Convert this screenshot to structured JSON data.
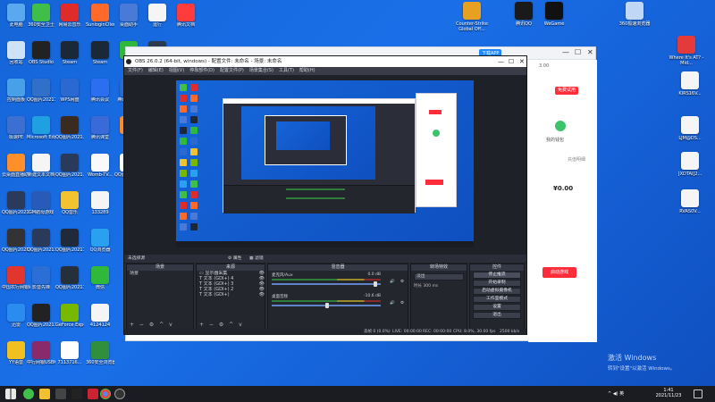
{
  "desktop": {
    "col1": [
      {
        "label": "此电脑",
        "color": "#5aa9f0"
      },
      {
        "label": "回收站",
        "color": "#cfe3f7"
      },
      {
        "label": "控制面板",
        "color": "#47a0e8"
      },
      {
        "label": "极速PE",
        "color": "#3b6fd1"
      },
      {
        "label": "云桌面直播助手",
        "color": "#ff8f2b"
      },
      {
        "label": "QQ图片20211017...",
        "color": "#2a3a5a"
      },
      {
        "label": "QQ图片20211017...",
        "color": "#333"
      },
      {
        "label": "中国农行网银助手",
        "color": "#e0362e"
      },
      {
        "label": "迅雷",
        "color": "#2b8cf0"
      },
      {
        "label": "YY语音",
        "color": "#f0c020"
      }
    ],
    "col2": [
      {
        "label": "360安全卫士",
        "color": "#3fbf4a"
      },
      {
        "label": "OBS Studio",
        "color": "#222"
      },
      {
        "label": "QQ图片20211017...",
        "color": "#3070c8"
      },
      {
        "label": "Microsoft Edge",
        "color": "#1fa0e0"
      },
      {
        "label": "新建文本文档",
        "color": "#f5f5f5"
      },
      {
        "label": "GM航母游戏",
        "color": "#2a5ab8"
      },
      {
        "label": "QQ图片20211016...",
        "color": "#2a3a5a"
      },
      {
        "label": "影音先锋",
        "color": "#2b6fd6"
      },
      {
        "label": "QQ图片20211017...",
        "color": "#222"
      },
      {
        "label": "中行网银USBKey",
        "color": "#8a2a6a"
      }
    ],
    "col3": [
      {
        "label": "网易云音乐",
        "color": "#e02b2b"
      },
      {
        "label": "Steam",
        "color": "#1b2838"
      },
      {
        "label": "WPS网盘",
        "color": "#2a6ad0"
      },
      {
        "label": "QQ图片2021...",
        "color": "#3a2a20"
      },
      {
        "label": "QQ图片2021...",
        "color": "#2a3a5a"
      },
      {
        "label": "QQ音乐",
        "color": "#f2c230"
      },
      {
        "label": "QQ图片20211016...",
        "color": "#202a3a"
      },
      {
        "label": "QQ图片20211016...",
        "color": "#25303a"
      },
      {
        "label": "GeForce Experience",
        "color": "#76b900"
      },
      {
        "label": "7113716...",
        "color": "#ffffff"
      }
    ],
    "col4": [
      {
        "label": "SunloginClient",
        "color": "#ff6a2b"
      },
      {
        "label": "Steam",
        "color": "#1b2838"
      },
      {
        "label": "腾讯会议",
        "color": "#2b6ff0"
      },
      {
        "label": "腾讯课堂",
        "color": "#3a6ad8"
      },
      {
        "label": "Womb-TV...",
        "color": "#fafafa"
      },
      {
        "label": "133289",
        "color": "#f5f5f5"
      },
      {
        "label": "QQ浏览器",
        "color": "#2aa0f0"
      },
      {
        "label": "微信",
        "color": "#2fb83a"
      },
      {
        "label": "4124124",
        "color": "#f5f5f5"
      },
      {
        "label": "360安全浏览器",
        "color": "#2f8f3a"
      }
    ],
    "col5": [
      {
        "label": "桌面助手",
        "color": "#4a7ad8"
      },
      {
        "label": "微信",
        "color": "#2fb83a"
      },
      {
        "label": "腾讯工作台",
        "color": "#2a6ad0"
      },
      {
        "label": "迅雷",
        "color": "#ff8a2a"
      },
      {
        "label": "QQ图片20211019...",
        "color": "#ffffff"
      }
    ],
    "col6": [
      {
        "label": "运行",
        "color": "#f5f5f5"
      },
      {
        "label": "英雄联盟WeGame版",
        "color": "#2a3a50"
      }
    ],
    "col7": [
      {
        "label": "腾讯文档",
        "color": "#ff3b3b"
      }
    ],
    "right": [
      {
        "label": "Counter-Strike Global Off...",
        "color": "#e8a020"
      },
      {
        "label": "腾讯QQ",
        "color": "#1a1a1a"
      },
      {
        "label": "WeGame",
        "color": "#111"
      },
      {
        "label": "360极速浏览器",
        "color": "#c0d8f5"
      },
      {
        "label": "Where It's AT? - Mid...",
        "color": "#e43a3a"
      },
      {
        "label": "KIRS16V...",
        "color": "#f5f5f5"
      },
      {
        "label": "LJM@DS...",
        "color": "#f5f5f5"
      },
      {
        "label": "[XDTAI]2...",
        "color": "#f5f5f5"
      },
      {
        "label": "RVAS0V...",
        "color": "#f5f5f5"
      }
    ]
  },
  "bg_window": {
    "title": "下载APP",
    "greeting": "3.00",
    "signup_button": "免费试用",
    "wallet_label": "我的钱包",
    "mine_label": "充值明细",
    "amount": "¥0.00",
    "play_button": "启动游戏",
    "controls": [
      "—",
      "☐",
      "✕"
    ]
  },
  "obs": {
    "title": "OBS 26.0.2 (64-bit, windows) - 配置文件: 未命名 - 场景: 未命名",
    "menu": [
      "文件(F)",
      "编辑(E)",
      "视图(V)",
      "停靠部件(D)",
      "配置文件(P)",
      "场景集合(S)",
      "工具(T)",
      "帮助(H)"
    ],
    "preview_bar": {
      "label": "未选择源",
      "props": "属性",
      "filters": "滤镜"
    },
    "panels": {
      "scenes": {
        "title": "场景",
        "items": [
          "场景"
        ]
      },
      "sources": {
        "title": "来源",
        "items": [
          "显示器采集",
          "文本 (GDI+) 4",
          "文本 (GDI+) 3",
          "文本 (GDI+) 2",
          "文本 (GDI+)"
        ]
      },
      "mixer": {
        "title": "混音器",
        "rows": [
          {
            "name": "麦克风/Aux",
            "db": "0.0 dB"
          },
          {
            "name": "桌面音频",
            "db": "-10.6 dB"
          }
        ]
      },
      "transitions": {
        "title": "转场特效",
        "mode": "淡出",
        "duration_label": "时长",
        "duration": "300 ms"
      },
      "controls": {
        "title": "控件",
        "buttons": [
          "停止推流",
          "开始录制",
          "启动虚拟摄像机",
          "工作室模式",
          "设置",
          "退出"
        ]
      }
    },
    "status": {
      "drops": "丢帧 0 (0.0%)",
      "live": "LIVE: 00:00:00",
      "rec": "REC: 00:00:00",
      "cpu": "CPU: 8.0%, 30.00 fps",
      "bitrate": "2500 kb/s"
    },
    "footer_controls": "+ − ⚙ ^ v"
  },
  "taskbar": {
    "time": "1:41",
    "date": "2021/11/23",
    "tray": "^ ◀) 英"
  },
  "watermark": {
    "line1": "激活 Windows",
    "line2": "转到\"设置\"以激活 Windows。"
  }
}
